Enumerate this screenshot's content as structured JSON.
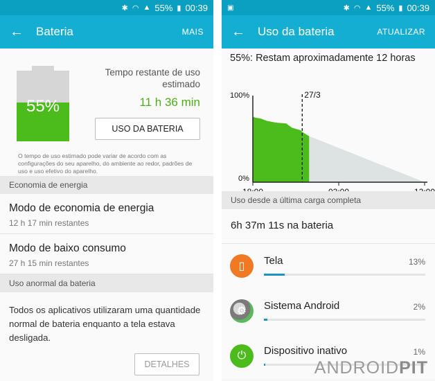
{
  "status": {
    "battery": "55%",
    "time": "00:39"
  },
  "left": {
    "appbar": {
      "title": "Bateria",
      "action": "MAIS"
    },
    "battery": {
      "percent_label": "55%",
      "level": 0.55,
      "estimate_label": "Tempo restante de uso estimado",
      "estimate_value": "11 h 36 min",
      "usage_button": "USO DA BATERIA",
      "disclaimer": "O tempo de uso estimado pode variar de acordo com as configurações do seu aparelho, do ambiente ao redor, padrões de uso e uso efetivo do aparelho."
    },
    "energy_section": {
      "header": "Economia de energia",
      "items": [
        {
          "title": "Modo de economia de energia",
          "subtitle": "12 h 17 min restantes"
        },
        {
          "title": "Modo de baixo consumo",
          "subtitle": "27 h 15 min restantes"
        }
      ]
    },
    "abnormal_section": {
      "header": "Uso anormal da bateria",
      "text": "Todos os aplicativos utilizaram uma quantidade normal de bateria enquanto a tela estava desligada.",
      "details_button": "DETALHES"
    }
  },
  "right": {
    "appbar": {
      "title": "Uso da bateria",
      "action": "ATUALIZAR"
    },
    "summary": "55%: Restam aproximadamente 12 horas",
    "chart_data": {
      "type": "area",
      "ylabels": [
        "100%",
        "0%"
      ],
      "xlabels": [
        "18:00",
        "03:00",
        "12:00"
      ],
      "marker": "27/3",
      "series": [
        {
          "kind": "actual",
          "color": "#4cbc1d",
          "x": [
            0,
            0.3,
            0.8,
            1.5,
            2.5,
            3.5,
            4.1,
            5.0,
            5.3,
            5.9
          ],
          "y": [
            78,
            77,
            76,
            73,
            71,
            70,
            65,
            62,
            59,
            55
          ]
        },
        {
          "kind": "predicted",
          "color": "#dde3e3",
          "x": [
            5.9,
            18
          ],
          "y": [
            55,
            0
          ]
        }
      ]
    },
    "usage_section": {
      "header": "Uso desde a última carga completa",
      "total": "6h 37m 11s na bateria"
    },
    "apps": [
      {
        "name": "Tela",
        "percent": "13%",
        "fraction": 0.13,
        "icon": "screen-icon",
        "color": "#f07a24"
      },
      {
        "name": "Sistema Android",
        "percent": "2%",
        "fraction": 0.02,
        "icon": "android-system-icon",
        "color": "#5ab85d"
      },
      {
        "name": "Dispositivo inativo",
        "percent": "1%",
        "fraction": 0.01,
        "icon": "power-icon",
        "color": "#4cbc1d"
      }
    ],
    "watermark": {
      "light": "ANDROID",
      "bold": "PIT"
    }
  }
}
